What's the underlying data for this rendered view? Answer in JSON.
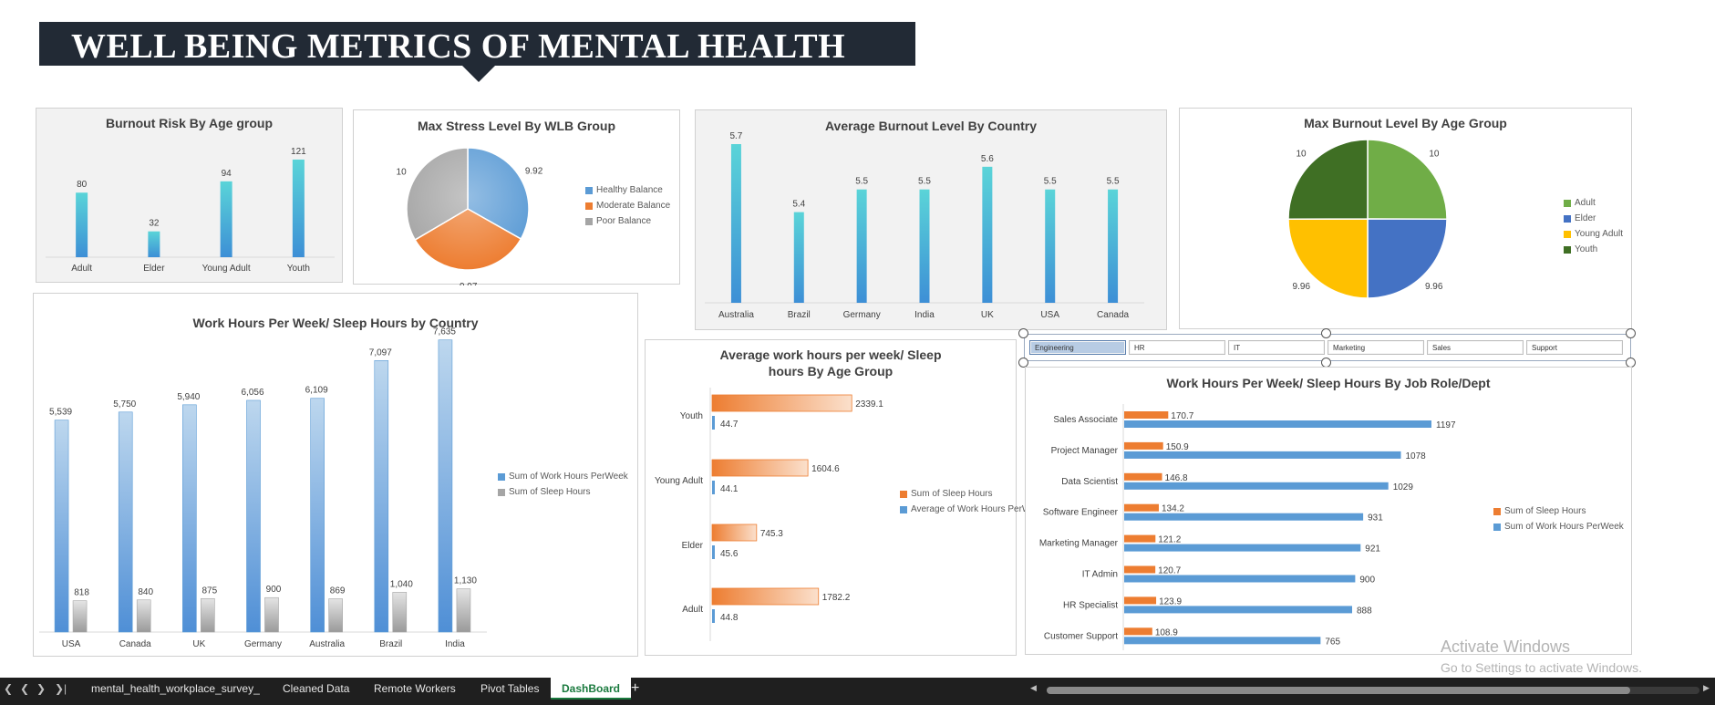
{
  "dashboard_title": "WELL BEING METRICS OF MENTAL HEALTH",
  "charts": {
    "burnout_risk": {
      "title": "Burnout Risk By Age group"
    },
    "max_stress": {
      "title": "Max Stress Level By WLB Group"
    },
    "avg_burnout_country": {
      "title": "Average Burnout Level By Country"
    },
    "max_burnout_age": {
      "title": "Max Burnout Level By Age Group"
    },
    "work_sleep_country": {
      "title": "Work Hours Per Week/ Sleep Hours by Country"
    },
    "work_sleep_age": {
      "title": "Average work hours per week/ Sleep hours By Age Group"
    },
    "work_sleep_role": {
      "title": "Work Hours Per Week/ Sleep Hours By Job Role/Dept"
    }
  },
  "chart_data": [
    {
      "id": "burnout_risk",
      "type": "bar",
      "title": "Burnout Risk By Age group",
      "categories": [
        "Adult",
        "Elder",
        "Young Adult",
        "Youth"
      ],
      "values": [
        80,
        32,
        94,
        121
      ],
      "ylim": [
        0,
        130
      ],
      "grid": true
    },
    {
      "id": "max_stress",
      "type": "pie",
      "title": "Max Stress Level By WLB Group",
      "categories": [
        "Healthy Balance",
        "Moderate Balance",
        "Poor Balance"
      ],
      "values": [
        9.92,
        9.97,
        10
      ],
      "legend": "right",
      "colors": [
        "#5b9bd5",
        "#ed7d31",
        "#a5a5a5"
      ]
    },
    {
      "id": "avg_burnout_country",
      "type": "bar",
      "title": "Average Burnout Level By Country",
      "categories": [
        "Australia",
        "Brazil",
        "Germany",
        "India",
        "UK",
        "USA",
        "Canada"
      ],
      "values": [
        5.7,
        5.4,
        5.5,
        5.5,
        5.6,
        5.5,
        5.5
      ],
      "grid": true
    },
    {
      "id": "max_burnout_age",
      "type": "pie",
      "title": "Max Burnout Level By Age Group",
      "categories": [
        "Adult",
        "Elder",
        "Young Adult",
        "Youth"
      ],
      "values": [
        10,
        9.96,
        9.96,
        10
      ],
      "legend": "right",
      "colors": [
        "#70ad47",
        "#4472c4",
        "#ffc000",
        "#3f6f24"
      ]
    },
    {
      "id": "work_sleep_country",
      "type": "bar",
      "title": "Work Hours Per Week/ Sleep Hours by Country",
      "categories": [
        "USA",
        "Canada",
        "UK",
        "Germany",
        "Australia",
        "Brazil",
        "India"
      ],
      "series": [
        {
          "name": "Sum of Work Hours PerWeek",
          "values": [
            5539,
            5750,
            5940,
            6056,
            6109,
            7097,
            7635
          ],
          "labels": [
            "5,539",
            "5,750",
            "5,940",
            "6,056",
            "6,109",
            "7,097",
            "7,635"
          ]
        },
        {
          "name": "Sum of Sleep Hours",
          "values": [
            818,
            840,
            875,
            900,
            869,
            1040,
            1130
          ],
          "labels": [
            "818",
            "840",
            "875",
            "900",
            "869",
            "1,040",
            "1,130"
          ]
        }
      ],
      "legend": "right"
    },
    {
      "id": "work_sleep_age",
      "type": "bar",
      "orientation": "horizontal",
      "title": "Average work hours per week/ Sleep hours By Age Group",
      "categories": [
        "Youth",
        "Young Adult",
        "Elder",
        "Adult"
      ],
      "series": [
        {
          "name": "Sum of Sleep Hours",
          "values": [
            2339.1,
            1604.6,
            745.3,
            1782.2
          ]
        },
        {
          "name": "Average of Work Hours PerWeek",
          "values": [
            44.7,
            44.1,
            45.6,
            44.8
          ]
        }
      ],
      "legend": "right"
    },
    {
      "id": "work_sleep_role",
      "type": "bar",
      "orientation": "horizontal",
      "title": "Work Hours Per Week/ Sleep Hours By Job Role/Dept",
      "categories": [
        "Sales Associate",
        "Project Manager",
        "Data Scientist",
        "Software Engineer",
        "Marketing Manager",
        "IT Admin",
        "HR Specialist",
        "Customer Support"
      ],
      "series": [
        {
          "name": "Sum of Sleep Hours",
          "values": [
            170.7,
            150.9,
            146.8,
            134.2,
            121.2,
            120.7,
            123.9,
            108.9
          ]
        },
        {
          "name": "Sum of Work Hours PerWeek",
          "values": [
            1197,
            1078,
            1029,
            931,
            921,
            900,
            888,
            765
          ]
        }
      ],
      "legend": "right"
    }
  ],
  "slicer": {
    "items": [
      "Engineering",
      "HR",
      "IT",
      "Marketing",
      "Sales",
      "Support"
    ],
    "selected": "Engineering"
  },
  "sheet_tabs": [
    "mental_health_workplace_survey_",
    "Cleaned Data",
    "Remote Workers",
    "Pivot Tables",
    "DashBoard"
  ],
  "active_tab": "DashBoard",
  "watermark": {
    "line1": "Activate Windows",
    "line2": "Go to Settings to activate Windows."
  },
  "colors": {
    "banner": "#222a35",
    "bar_teal": "#4bc8cf",
    "bar_blue": "#5b9bd5",
    "orange": "#ed7d31",
    "grey": "#a5a5a5",
    "tab_active": "#1a7a3e"
  }
}
